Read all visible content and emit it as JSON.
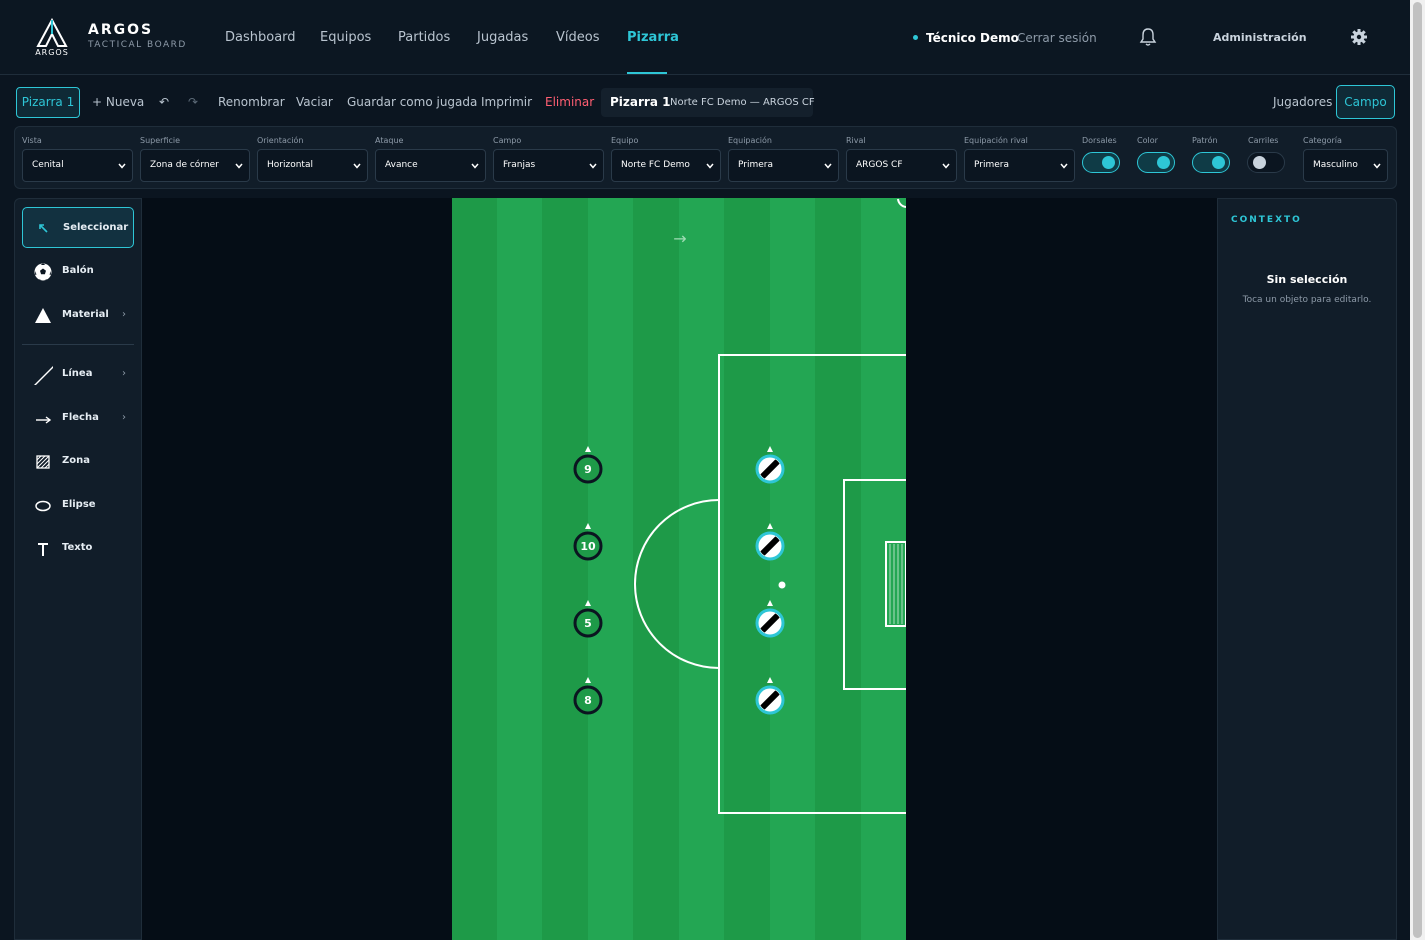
{
  "brand": {
    "name": "ARGOS",
    "tagline": "TACTICAL BOARD",
    "mark_text": "ARGOS"
  },
  "nav": {
    "items": [
      "Dashboard",
      "Equipos",
      "Partidos",
      "Jugadas",
      "Vídeos",
      "Pizarra"
    ],
    "active": "Pizarra"
  },
  "user": {
    "name": "Técnico Demo",
    "logout": "Cerrar sesión",
    "admin": "Administración"
  },
  "toolbar": {
    "board_tab": "Pizarra 1",
    "new": "+ Nueva",
    "undo": "↶",
    "redo": "↷",
    "rename": "Renombrar",
    "clear": "Vaciar",
    "save_play": "Guardar como jugada",
    "print": "Imprimir",
    "delete": "Eliminar",
    "board_title": "Pizarra 1",
    "match": "Norte FC Demo — ARGOS CF",
    "players": "Jugadores",
    "field": "Campo"
  },
  "settings": {
    "vista": {
      "label": "Vista",
      "value": "Cenital"
    },
    "superficie": {
      "label": "Superficie",
      "value": "Zona de córner"
    },
    "orientacion": {
      "label": "Orientación",
      "value": "Horizontal"
    },
    "ataque": {
      "label": "Ataque",
      "value": "Avance"
    },
    "campo": {
      "label": "Campo",
      "value": "Franjas"
    },
    "equipo": {
      "label": "Equipo",
      "value": "Norte FC Demo"
    },
    "equipacion": {
      "label": "Equipación",
      "value": "Primera"
    },
    "rival": {
      "label": "Rival",
      "value": "ARGOS CF"
    },
    "equipacion_rival": {
      "label": "Equipación rival",
      "value": "Primera"
    },
    "dorsales": {
      "label": "Dorsales",
      "on": true
    },
    "color": {
      "label": "Color",
      "on": true
    },
    "patron": {
      "label": "Patrón",
      "on": true
    },
    "carriles": {
      "label": "Carriles",
      "on": false
    },
    "categoria": {
      "label": "Categoría",
      "value": "Masculino"
    }
  },
  "tools": {
    "select": "Seleccionar",
    "ball": "Balón",
    "material": "Material",
    "line": "Línea",
    "arrow": "Flecha",
    "zone": "Zona",
    "ellipse": "Elipse",
    "text": "Texto"
  },
  "board": {
    "home_numbers": [
      "9",
      "10",
      "5",
      "8"
    ],
    "home_color": "#1e9a48",
    "away_pattern_colors": [
      "#ffffff",
      "#000000"
    ],
    "away_ring_color": "#2ec6d6",
    "pitch_color": "#1e9a48",
    "attack_arrow": "→"
  },
  "context": {
    "title": "CONTEXTO",
    "empty": "Sin selección",
    "hint": "Toca un objeto para editarlo."
  },
  "colors": {
    "accent": "#2ec6d6",
    "danger": "#ff5e72",
    "background": "#0b1520"
  }
}
